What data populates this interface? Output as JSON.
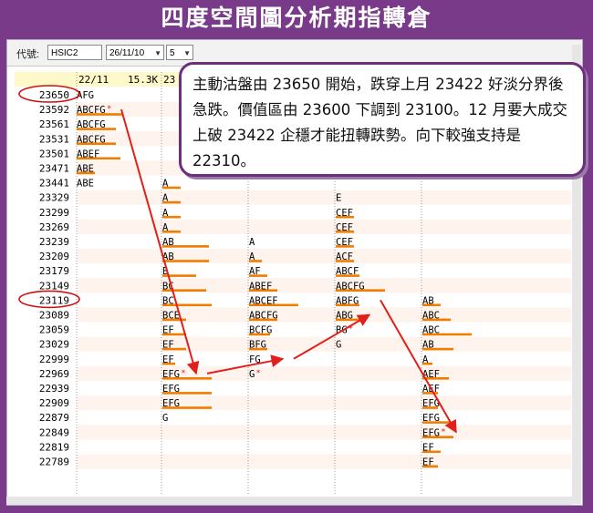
{
  "title": "四度空間圖分析期指轉倉",
  "toolbar": {
    "code_label": "代號:",
    "code_value": "HSIC2",
    "date_value": "26/11/10",
    "period_value": "5"
  },
  "callout": {
    "text": "主動沽盤由 23650 開始，跌穿上月 23422 好淡分界後急跌。價值區由 23600 下調到 23100。12 月要大成交上破 23422 企穩才能扭轉跌勢。向下較強支持是 22310。"
  },
  "colors": {
    "banner": "#7a3a8a",
    "bar": "#f07c00",
    "arrow": "#e0201a",
    "circle": "#cc1111",
    "header_bg": "#fff8c8",
    "row_stripe": "#fff3ee"
  },
  "chart_data": {
    "type": "table",
    "header": {
      "date": "22/11",
      "volume": "15.3K",
      "next": "23"
    },
    "prices": [
      23650,
      23592,
      23561,
      23531,
      23501,
      23471,
      23441,
      23329,
      23299,
      23269,
      23239,
      23209,
      23179,
      23149,
      23119,
      23089,
      23059,
      23029,
      22999,
      22969,
      22939,
      22909,
      22879,
      22849,
      22819,
      22789
    ],
    "circled_prices": [
      23650,
      23119
    ],
    "columns": [
      {
        "rows": {
          "23650": "AFG",
          "23592": "ABCFG",
          "23561": "ABCFG",
          "23531": "ABCFG",
          "23501": "ABEF",
          "23471": "ABE",
          "23441": "ABE"
        },
        "bars": {
          "23592": 0.9,
          "23561": 0.75,
          "23531": 0.75,
          "23501": 0.85,
          "23471": 0.35
        },
        "marks": [
          "23592"
        ]
      },
      {
        "rows": {
          "23441": "A",
          "23329": "A",
          "23299": "A",
          "23269": "A",
          "23239": "AB",
          "23209": "AB",
          "23179": "B",
          "23149": "BC",
          "23119": "BC",
          "23089": "BCE",
          "23059": "EF",
          "23029": "EF",
          "22999": "EF",
          "22969": "EFG",
          "22939": "EFG",
          "22909": "EFG",
          "22879": "G"
        },
        "bars": {
          "23441": 0.35,
          "23329": 0.35,
          "23299": 0.35,
          "23269": 0.35,
          "23239": 0.9,
          "23209": 0.9,
          "23179": 0.65,
          "23149": 0.85,
          "23119": 0.95,
          "23089": 0.45,
          "23059": 0.45,
          "23029": 0.45,
          "22999": 0.25,
          "22969": 0.95,
          "22939": 0.95,
          "22909": 0.95
        },
        "marks": [
          "22969"
        ]
      },
      {
        "rows": {
          "23239": "A",
          "23209": "A",
          "23179": "AF",
          "23149": "ABEF",
          "23119": "ABCEF",
          "23089": "ABCFG",
          "23059": "BCFG",
          "23029": "BFG",
          "22999": "FG",
          "22969": "G"
        },
        "bars": {
          "23209": 0.25,
          "23179": 0.35,
          "23149": 0.55,
          "23119": 0.95,
          "23089": 0.55,
          "23059": 0.4,
          "23029": 0.35
        },
        "marks": [
          "22969"
        ]
      },
      {
        "rows": {
          "23329": "E",
          "23299": "CEF",
          "23269": "CEF",
          "23239": "CEF",
          "23209": "ACF",
          "23179": "ABCF",
          "23149": "ABCFG",
          "23119": "ABFG",
          "23089": "ABG",
          "23059": "BG",
          "23029": "G"
        },
        "bars": {
          "23299": 0.35,
          "23269": 0.35,
          "23239": 0.35,
          "23209": 0.35,
          "23179": 0.45,
          "23149": 0.95,
          "23119": 0.45,
          "23089": 0.45
        },
        "marks": [
          "23059"
        ]
      },
      {
        "rows": {
          "23119": "AB",
          "23089": "ABC",
          "23059": "ABC",
          "23029": "AB",
          "22999": "A",
          "22969": "AEF",
          "22939": "AEF",
          "22909": "EFG",
          "22879": "EFG",
          "22849": "EFG",
          "22819": "EF",
          "22789": "EF"
        },
        "bars": {
          "23119": 0.35,
          "23089": 0.55,
          "23059": 0.95,
          "23029": 0.6,
          "22999": 0.2,
          "22969": 0.5,
          "22939": 0.3,
          "22909": 0.3,
          "22879": 0.55,
          "22849": 0.6,
          "22819": 0.35,
          "22789": 0.3
        },
        "marks": [
          "22849"
        ]
      }
    ],
    "arrows": [
      {
        "from": {
          "col": 0,
          "price": 23592
        },
        "to": {
          "col": 1,
          "price": 22969
        }
      },
      {
        "from": {
          "col": 1,
          "price": 22969
        },
        "to": {
          "col": 2,
          "price": 22999
        }
      },
      {
        "from": {
          "col": 2,
          "price": 22999
        },
        "to": {
          "col": 3,
          "price": 23089
        }
      },
      {
        "from": {
          "col": 3,
          "price": 23119
        },
        "to": {
          "col": 4,
          "price": 22849
        }
      }
    ]
  }
}
